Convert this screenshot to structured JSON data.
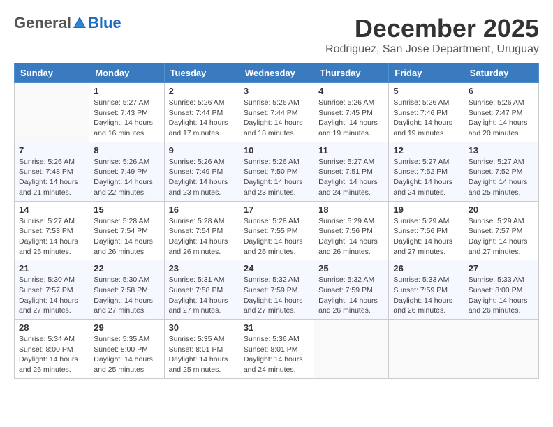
{
  "logo": {
    "general": "General",
    "blue": "Blue"
  },
  "title": "December 2025",
  "location": "Rodriguez, San Jose Department, Uruguay",
  "days_of_week": [
    "Sunday",
    "Monday",
    "Tuesday",
    "Wednesday",
    "Thursday",
    "Friday",
    "Saturday"
  ],
  "weeks": [
    [
      {
        "day": "",
        "content": ""
      },
      {
        "day": "1",
        "content": "Sunrise: 5:27 AM\nSunset: 7:43 PM\nDaylight: 14 hours\nand 16 minutes."
      },
      {
        "day": "2",
        "content": "Sunrise: 5:26 AM\nSunset: 7:44 PM\nDaylight: 14 hours\nand 17 minutes."
      },
      {
        "day": "3",
        "content": "Sunrise: 5:26 AM\nSunset: 7:44 PM\nDaylight: 14 hours\nand 18 minutes."
      },
      {
        "day": "4",
        "content": "Sunrise: 5:26 AM\nSunset: 7:45 PM\nDaylight: 14 hours\nand 19 minutes."
      },
      {
        "day": "5",
        "content": "Sunrise: 5:26 AM\nSunset: 7:46 PM\nDaylight: 14 hours\nand 19 minutes."
      },
      {
        "day": "6",
        "content": "Sunrise: 5:26 AM\nSunset: 7:47 PM\nDaylight: 14 hours\nand 20 minutes."
      }
    ],
    [
      {
        "day": "7",
        "content": "Sunrise: 5:26 AM\nSunset: 7:48 PM\nDaylight: 14 hours\nand 21 minutes."
      },
      {
        "day": "8",
        "content": "Sunrise: 5:26 AM\nSunset: 7:49 PM\nDaylight: 14 hours\nand 22 minutes."
      },
      {
        "day": "9",
        "content": "Sunrise: 5:26 AM\nSunset: 7:49 PM\nDaylight: 14 hours\nand 23 minutes."
      },
      {
        "day": "10",
        "content": "Sunrise: 5:26 AM\nSunset: 7:50 PM\nDaylight: 14 hours\nand 23 minutes."
      },
      {
        "day": "11",
        "content": "Sunrise: 5:27 AM\nSunset: 7:51 PM\nDaylight: 14 hours\nand 24 minutes."
      },
      {
        "day": "12",
        "content": "Sunrise: 5:27 AM\nSunset: 7:52 PM\nDaylight: 14 hours\nand 24 minutes."
      },
      {
        "day": "13",
        "content": "Sunrise: 5:27 AM\nSunset: 7:52 PM\nDaylight: 14 hours\nand 25 minutes."
      }
    ],
    [
      {
        "day": "14",
        "content": "Sunrise: 5:27 AM\nSunset: 7:53 PM\nDaylight: 14 hours\nand 25 minutes."
      },
      {
        "day": "15",
        "content": "Sunrise: 5:28 AM\nSunset: 7:54 PM\nDaylight: 14 hours\nand 26 minutes."
      },
      {
        "day": "16",
        "content": "Sunrise: 5:28 AM\nSunset: 7:54 PM\nDaylight: 14 hours\nand 26 minutes."
      },
      {
        "day": "17",
        "content": "Sunrise: 5:28 AM\nSunset: 7:55 PM\nDaylight: 14 hours\nand 26 minutes."
      },
      {
        "day": "18",
        "content": "Sunrise: 5:29 AM\nSunset: 7:56 PM\nDaylight: 14 hours\nand 26 minutes."
      },
      {
        "day": "19",
        "content": "Sunrise: 5:29 AM\nSunset: 7:56 PM\nDaylight: 14 hours\nand 27 minutes."
      },
      {
        "day": "20",
        "content": "Sunrise: 5:29 AM\nSunset: 7:57 PM\nDaylight: 14 hours\nand 27 minutes."
      }
    ],
    [
      {
        "day": "21",
        "content": "Sunrise: 5:30 AM\nSunset: 7:57 PM\nDaylight: 14 hours\nand 27 minutes."
      },
      {
        "day": "22",
        "content": "Sunrise: 5:30 AM\nSunset: 7:58 PM\nDaylight: 14 hours\nand 27 minutes."
      },
      {
        "day": "23",
        "content": "Sunrise: 5:31 AM\nSunset: 7:58 PM\nDaylight: 14 hours\nand 27 minutes."
      },
      {
        "day": "24",
        "content": "Sunrise: 5:32 AM\nSunset: 7:59 PM\nDaylight: 14 hours\nand 27 minutes."
      },
      {
        "day": "25",
        "content": "Sunrise: 5:32 AM\nSunset: 7:59 PM\nDaylight: 14 hours\nand 26 minutes."
      },
      {
        "day": "26",
        "content": "Sunrise: 5:33 AM\nSunset: 7:59 PM\nDaylight: 14 hours\nand 26 minutes."
      },
      {
        "day": "27",
        "content": "Sunrise: 5:33 AM\nSunset: 8:00 PM\nDaylight: 14 hours\nand 26 minutes."
      }
    ],
    [
      {
        "day": "28",
        "content": "Sunrise: 5:34 AM\nSunset: 8:00 PM\nDaylight: 14 hours\nand 26 minutes."
      },
      {
        "day": "29",
        "content": "Sunrise: 5:35 AM\nSunset: 8:00 PM\nDaylight: 14 hours\nand 25 minutes."
      },
      {
        "day": "30",
        "content": "Sunrise: 5:35 AM\nSunset: 8:01 PM\nDaylight: 14 hours\nand 25 minutes."
      },
      {
        "day": "31",
        "content": "Sunrise: 5:36 AM\nSunset: 8:01 PM\nDaylight: 14 hours\nand 24 minutes."
      },
      {
        "day": "",
        "content": ""
      },
      {
        "day": "",
        "content": ""
      },
      {
        "day": "",
        "content": ""
      }
    ]
  ]
}
